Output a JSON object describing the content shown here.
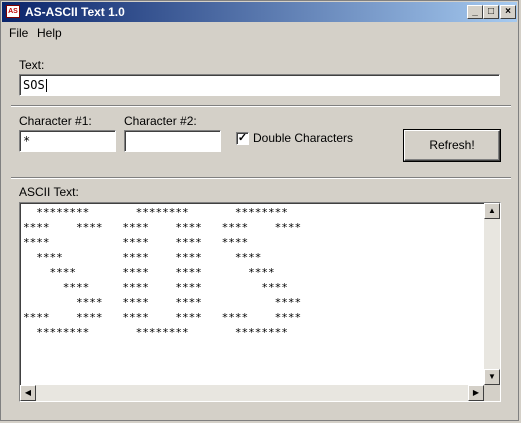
{
  "window": {
    "title": "AS-ASCII Text 1.0",
    "app_icon_text": "AS"
  },
  "menu": {
    "file": "File",
    "help": "Help"
  },
  "text_field": {
    "label": "Text:",
    "value": "SOS"
  },
  "char1": {
    "label": "Character #1:",
    "value": "*"
  },
  "char2": {
    "label": "Character #2:",
    "value": ""
  },
  "double_chars": {
    "label": "Double Characters",
    "checked": true
  },
  "refresh_button": {
    "label": "Refresh!"
  },
  "ascii_output": {
    "label": "ASCII Text:",
    "content": "  ********       ********       ********\n****    ****   ****    ****   ****    ****\n****           ****    ****   ****\n  ****         ****    ****     ****\n    ****       ****    ****       ****\n      ****     ****    ****         ****\n        ****   ****    ****           ****\n****    ****   ****    ****   ****    ****\n  ********       ********       ********"
  },
  "icons": {
    "minimize": "minimize-icon",
    "maximize": "maximize-icon",
    "close": "close-icon"
  }
}
